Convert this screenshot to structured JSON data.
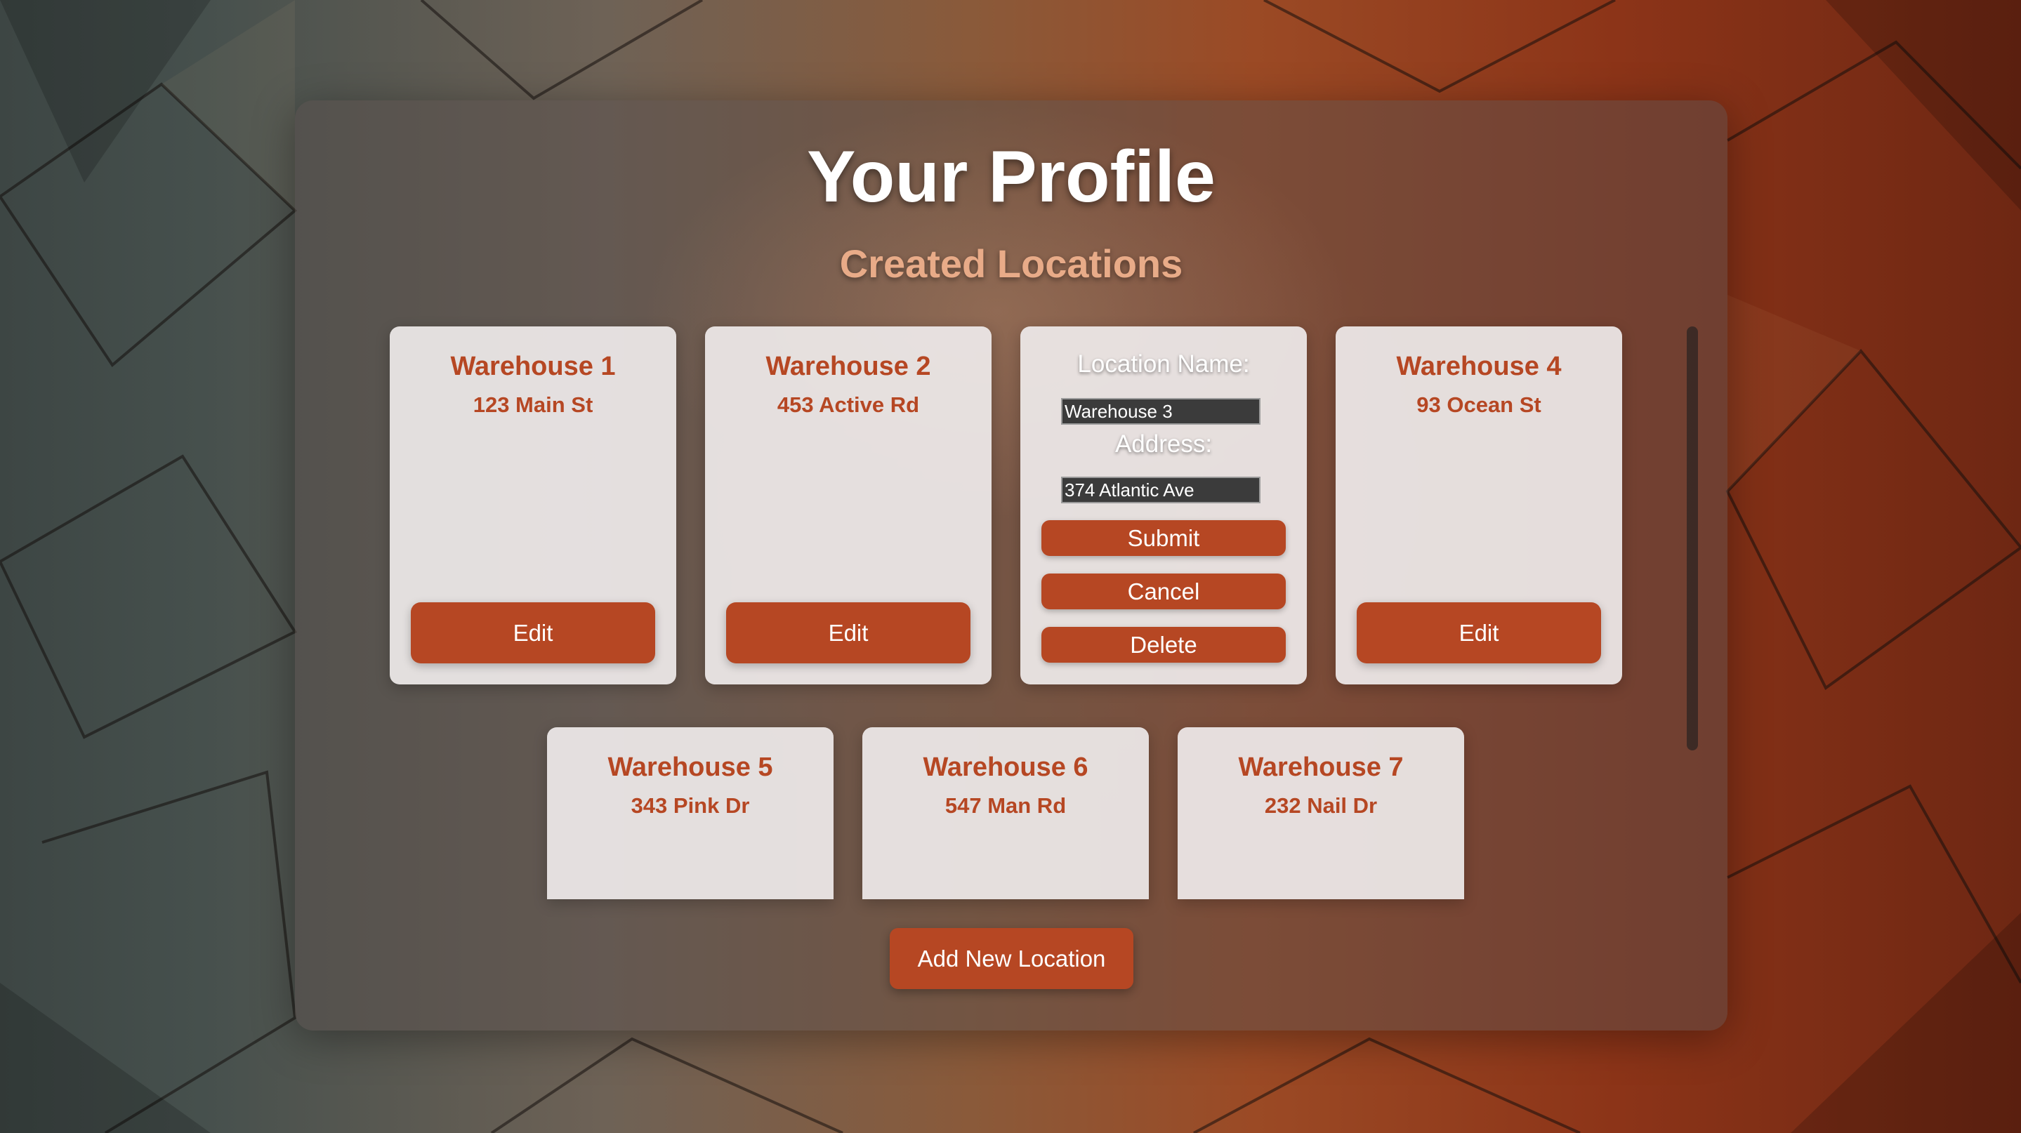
{
  "page": {
    "title": "Your Profile",
    "subtitle": "Created Locations"
  },
  "colors": {
    "accent": "#b64723",
    "subtitle": "#e8ab88",
    "card_bg": "#eeeae9"
  },
  "locations": [
    {
      "name": "Warehouse 1",
      "address": "123 Main St",
      "edit_label": "Edit"
    },
    {
      "name": "Warehouse 2",
      "address": "453 Active Rd",
      "edit_label": "Edit"
    },
    {
      "name": "Warehouse 4",
      "address": "93 Ocean St",
      "edit_label": "Edit"
    },
    {
      "name": "Warehouse 5",
      "address": "343 Pink Dr"
    },
    {
      "name": "Warehouse 6",
      "address": "547 Man Rd"
    },
    {
      "name": "Warehouse 7",
      "address": "232 Nail Dr"
    }
  ],
  "edit_form": {
    "name_label": "Location Name:",
    "name_value": "Warehouse 3",
    "address_label": "Address:",
    "address_value": "374 Atlantic Ave",
    "submit_label": "Submit",
    "cancel_label": "Cancel",
    "delete_label": "Delete"
  },
  "add_button_label": "Add New Location"
}
